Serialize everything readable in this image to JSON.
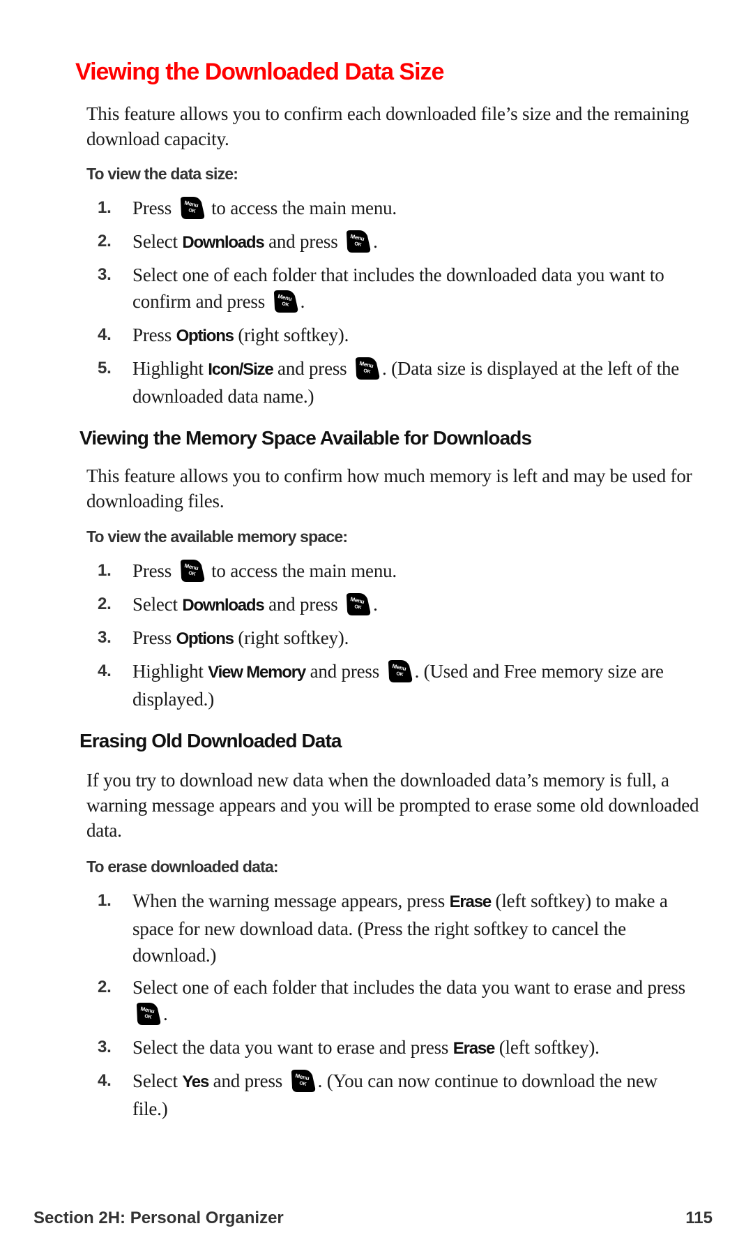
{
  "sections": [
    {
      "title": "Viewing the Downloaded Data Size",
      "intro": "This feature allows you to confirm each downloaded file’s size and the remaining download capacity.",
      "procedure_label": "To view the data size:",
      "steps": [
        {
          "num": "1.",
          "parts": [
            "Press ",
            "",
            " to access the main menu."
          ]
        },
        {
          "num": "2.",
          "parts": [
            "Select ",
            "Downloads",
            " and press ",
            "",
            "."
          ]
        },
        {
          "num": "3.",
          "parts": [
            "Select one of each folder that includes the downloaded data you want to confirm and press ",
            "",
            "."
          ]
        },
        {
          "num": "4.",
          "parts": [
            "Press ",
            "Options",
            " (right softkey)."
          ]
        },
        {
          "num": "5.",
          "parts": [
            "Highlight ",
            "Icon/Size",
            " and press ",
            "",
            ". (Data size is displayed at the left of the downloaded data name.)"
          ]
        }
      ]
    },
    {
      "title": "Viewing the Memory Space Available for Downloads",
      "intro": "This feature allows you to confirm how much memory is left and may be used for downloading files.",
      "procedure_label": "To view the available memory space:",
      "steps": [
        {
          "num": "1.",
          "parts": [
            "Press ",
            "",
            " to access the main menu."
          ]
        },
        {
          "num": "2.",
          "parts": [
            "Select ",
            "Downloads",
            " and press ",
            "",
            "."
          ]
        },
        {
          "num": "3.",
          "parts": [
            "Press ",
            "Options",
            " (right softkey)."
          ]
        },
        {
          "num": "4.",
          "parts": [
            "Highlight ",
            "View Memory",
            " and press ",
            "",
            ". (Used and Free memory size are displayed.)"
          ]
        }
      ]
    },
    {
      "title": "Erasing Old Downloaded Data",
      "intro": "If you try to download new data when the downloaded data’s memory is full, a warning message appears and you will be prompted to erase some old downloaded data.",
      "procedure_label": "To erase downloaded data:",
      "steps": [
        {
          "num": "1.",
          "parts": [
            "When the warning message appears, press ",
            "Erase",
            " (left softkey) to make a space for new download data. (Press the right softkey to cancel the download.)"
          ]
        },
        {
          "num": "2.",
          "parts": [
            "Select one of each folder that includes the data you want to erase and press ",
            "",
            "."
          ]
        },
        {
          "num": "3.",
          "parts": [
            "Select the data you want to erase and press ",
            "Erase",
            " (left softkey)."
          ]
        },
        {
          "num": "4.",
          "parts": [
            "Select ",
            "Yes",
            " and press ",
            "",
            ". (You can now continue to download the new file.)"
          ]
        }
      ]
    }
  ],
  "key_icon": {
    "name": "menu-ok-key-icon",
    "line1": "Menu",
    "line2": "OK"
  },
  "footer": {
    "section": "Section 2H: Personal Organizer",
    "page_number": "115"
  },
  "colors": {
    "heading_red": "#ff0000",
    "text": "#1a1a1a",
    "subhead_gray": "#333333"
  }
}
